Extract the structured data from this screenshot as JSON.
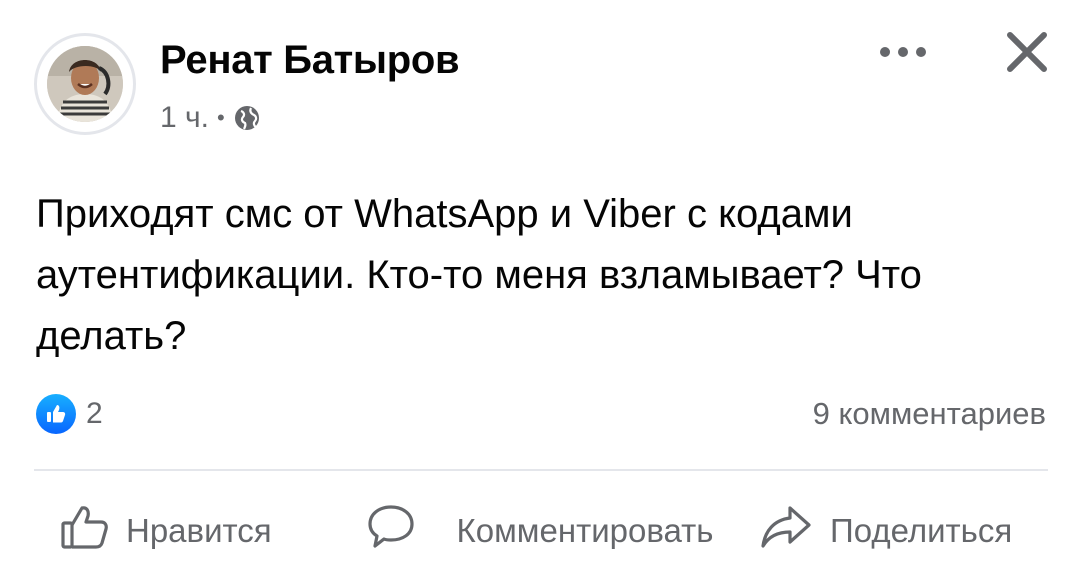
{
  "author": {
    "name": "Ренат Батыров",
    "time": "1 ч.",
    "separator": "•",
    "audience_icon": "globe-icon"
  },
  "header_actions": {
    "more_icon": "more-options-icon",
    "close_icon": "close-icon"
  },
  "post": {
    "text": "Приходят смс от WhatsApp и Viber с кодами аутентификации. Кто-то меня взламывает? Что делать?"
  },
  "stats": {
    "reaction_icon": "like-reaction-icon",
    "reactions": "2",
    "comments": "9 комментариев"
  },
  "actions": {
    "like": {
      "label": "Нравится",
      "icon": "thumbs-up-icon"
    },
    "comment": {
      "label": "Комментировать",
      "icon": "comment-bubble-icon"
    },
    "share": {
      "label": "Поделиться",
      "icon": "share-arrow-icon"
    }
  },
  "colors": {
    "text_primary": "#050505",
    "text_secondary": "#65676b",
    "divider": "#e4e6eb",
    "like_blue": "#0866ff"
  }
}
